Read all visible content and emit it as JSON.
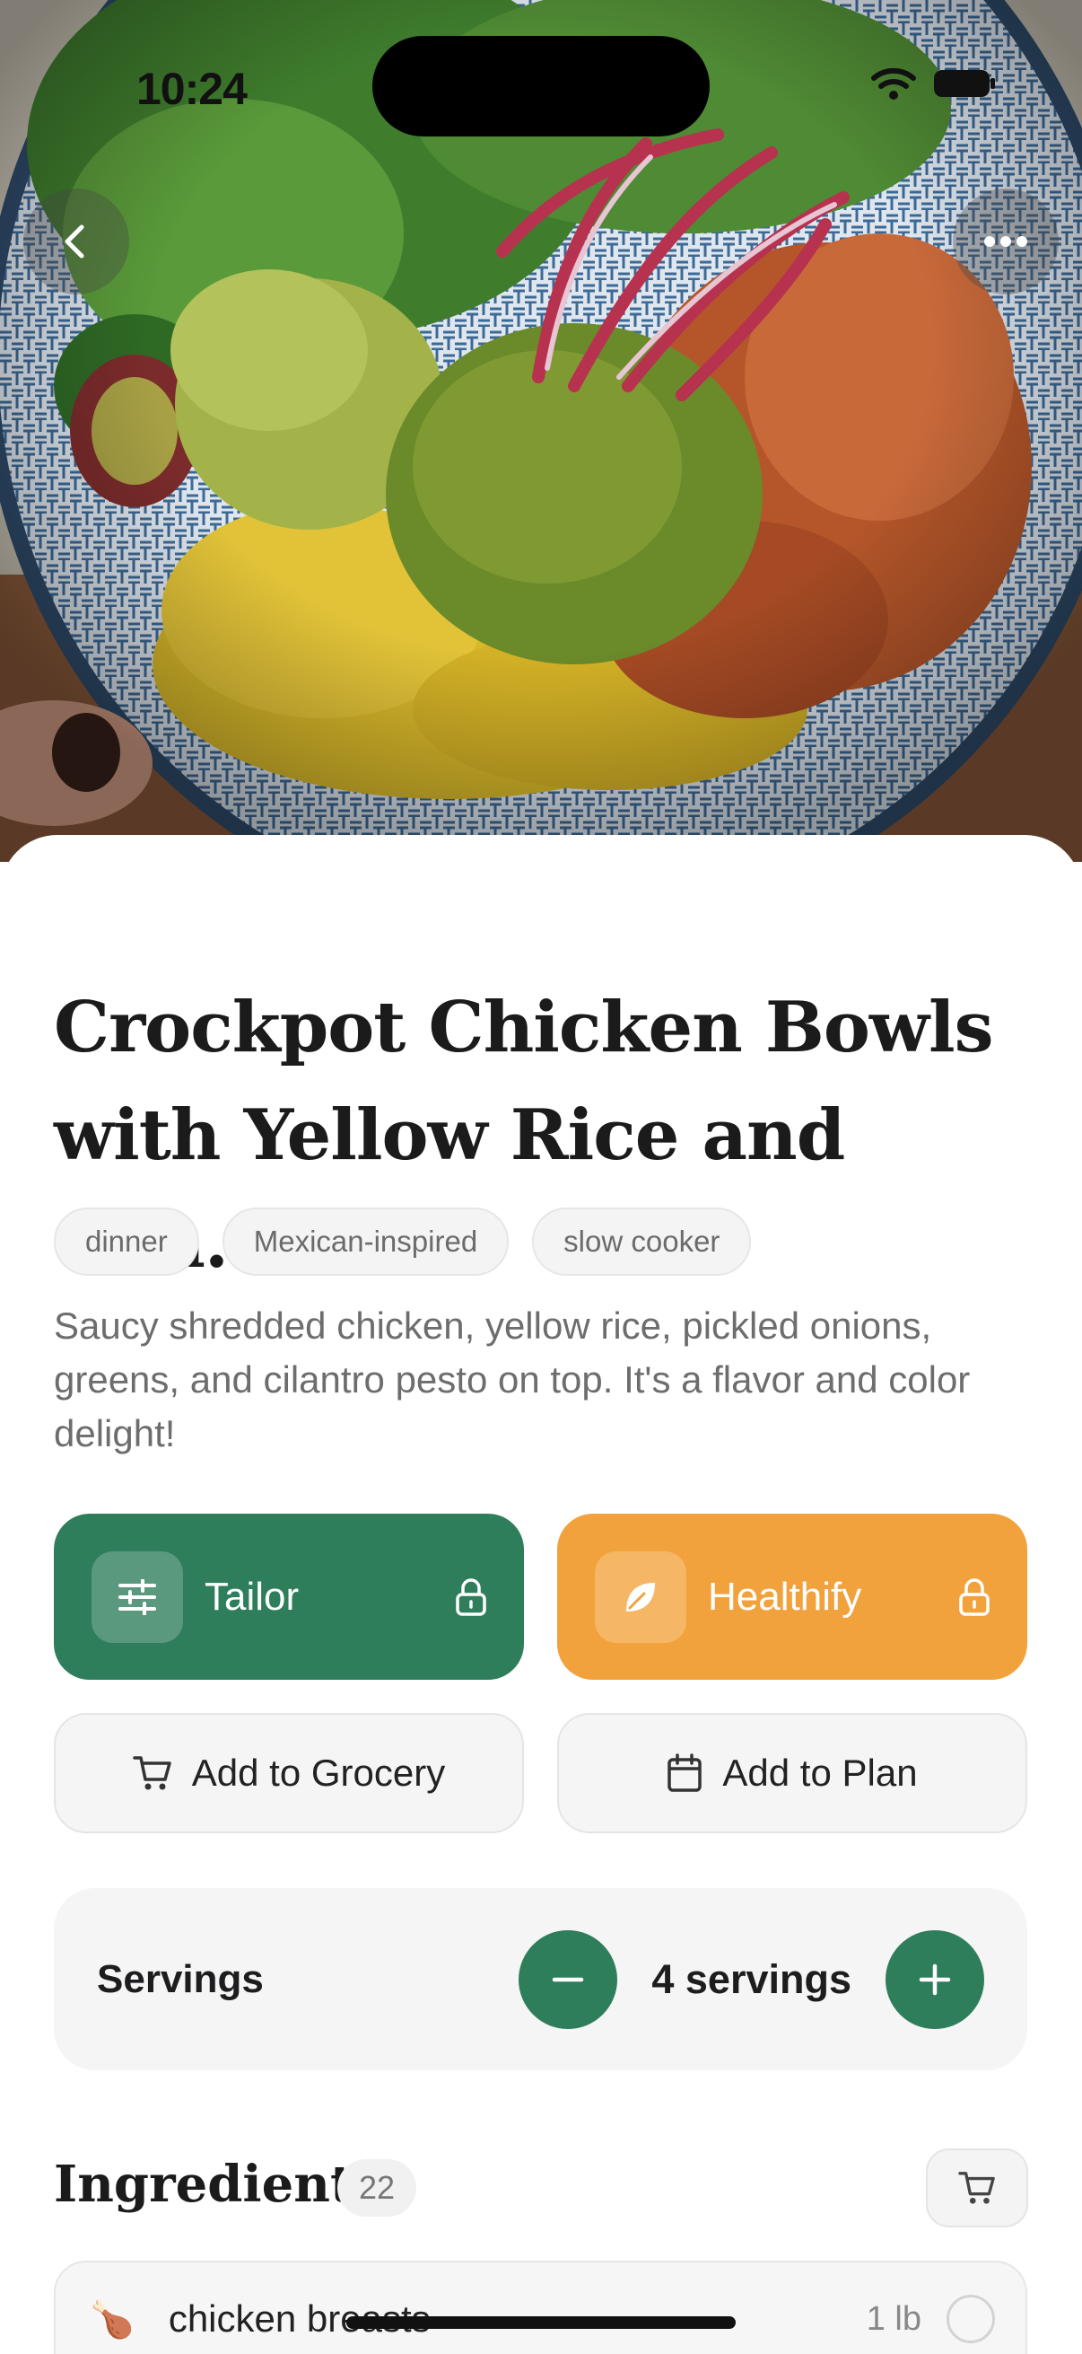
{
  "status_bar": {
    "time": "10:24"
  },
  "hero": {
    "image_alt": "Bowl with greens, guacamole, cilantro pesto, pickled onions, shredded chicken and yellow rice"
  },
  "recipe": {
    "title": "Crockpot Chicken Bowls with Yellow Rice and Cila...",
    "tags": [
      "dinner",
      "Mexican-inspired",
      "slow cooker"
    ],
    "description": "Saucy shredded chicken, yellow rice, pickled onions, greens, and cilantro pesto on top. It's a flavor and color delight!"
  },
  "actions": {
    "tailor_label": "Tailor",
    "healthify_label": "Healthify",
    "grocery_label": "Add to Grocery",
    "plan_label": "Add to Plan"
  },
  "servings": {
    "label": "Servings",
    "value": "4 servings"
  },
  "ingredients": {
    "heading": "Ingredients",
    "count": "22",
    "items": [
      {
        "emoji": "🍗",
        "name": "chicken breasts",
        "qty": "1 lb"
      }
    ]
  },
  "colors": {
    "primary_green": "#2e7d5b",
    "healthify_orange": "#f2a23c"
  },
  "icons": [
    "back-chevron-icon",
    "more-dots-icon",
    "sliders-icon",
    "leaf-icon",
    "lock-icon",
    "cart-icon",
    "calendar-icon",
    "minus-icon",
    "plus-icon",
    "wifi-icon",
    "battery-icon"
  ]
}
